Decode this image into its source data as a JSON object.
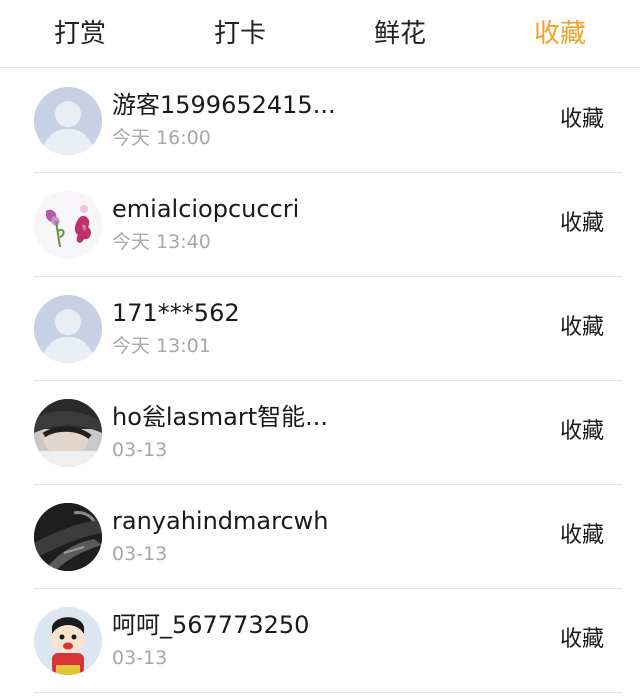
{
  "tabs": [
    {
      "label": "打赏",
      "active": false
    },
    {
      "label": "打卡",
      "active": false
    },
    {
      "label": "鲜花",
      "active": false
    },
    {
      "label": "收藏",
      "active": true
    }
  ],
  "accent_color": "#f0a223",
  "rows": [
    {
      "name": "游客1599652415...",
      "time": "今天 16:00",
      "action": "收藏",
      "avatar_icon": "default-user-icon"
    },
    {
      "name": "emialciopcuccri",
      "time": "今天 13:40",
      "action": "收藏",
      "avatar_icon": "flowers-photo"
    },
    {
      "name": "171***562",
      "time": "今天 13:01",
      "action": "收藏",
      "avatar_icon": "default-user-icon"
    },
    {
      "name": "ho瓮lasmart智能...",
      "time": "03-13",
      "action": "收藏",
      "avatar_icon": "sleeping-person-photo"
    },
    {
      "name": "ranyahindmarcwh",
      "time": "03-13",
      "action": "收藏",
      "avatar_icon": "dark-photo"
    },
    {
      "name": "呵呵_567773250",
      "time": "03-13",
      "action": "收藏",
      "avatar_icon": "cartoon-boy-photo"
    }
  ]
}
